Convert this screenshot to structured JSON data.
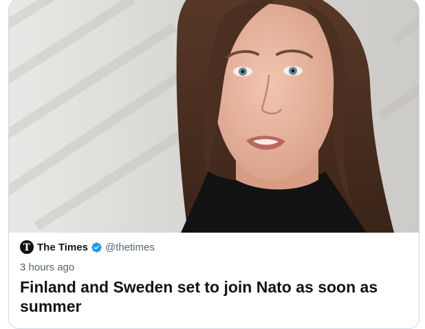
{
  "card": {
    "image": {
      "alt": "portrait photo",
      "description_name": "news-photo"
    },
    "source": {
      "logo_letter": "T",
      "name": "The Times",
      "handle": "@thetimes",
      "verified": true
    },
    "time_ago": "3 hours ago",
    "headline": "Finland and Sweden set to join Nato as soon as summer"
  },
  "colors": {
    "border": "#cfd9de",
    "verified_blue": "#1d9bf0",
    "secondary_text": "#536471",
    "primary_text": "#0f1419"
  },
  "icons": {
    "verified": "verified-badge-icon",
    "logo": "the-times-logo"
  }
}
